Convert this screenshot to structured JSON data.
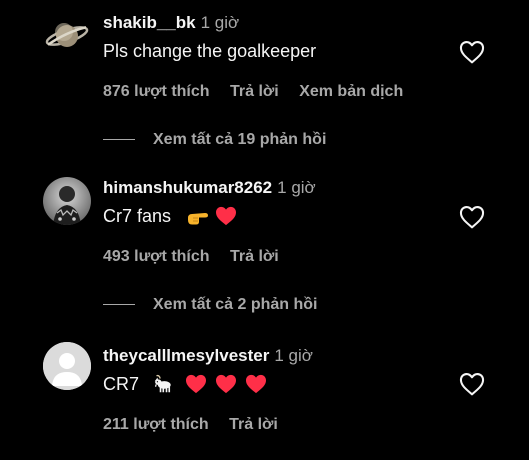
{
  "comments": [
    {
      "username": "shakib__bk",
      "time": "1 giờ",
      "text": "Pls change the goalkeeper",
      "likes": "876 lượt thích",
      "reply_label": "Trả lời",
      "translate_label": "Xem bản dịch",
      "view_replies": "Xem tất cả 19 phản hồi"
    },
    {
      "username": "himanshukumar8262",
      "time": "1 giờ",
      "text": "Cr7 fans",
      "likes": "493 lượt thích",
      "reply_label": "Trả lời",
      "view_replies": "Xem tất cả 2 phản hồi"
    },
    {
      "username": "theycalllmesylvester",
      "time": "1 giờ",
      "text": "CR7",
      "likes": "211 lượt thích",
      "reply_label": "Trả lời"
    }
  ],
  "colors": {
    "background": "#000000",
    "primary_text": "#f5f5f5",
    "secondary_text": "#a8a8a8",
    "heart_red": "#ff2f48"
  },
  "icons": {
    "like": "heart-outline-icon",
    "emoji_point": "backhand-index-pointing-right-emoji",
    "emoji_heart": "red-heart-emoji",
    "emoji_goat": "goat-emoji"
  }
}
